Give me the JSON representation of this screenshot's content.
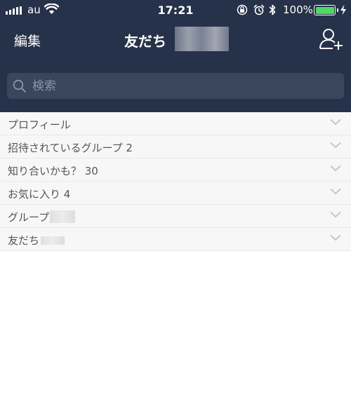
{
  "status_bar": {
    "carrier": "au",
    "time": "17:21",
    "battery_percent": "100%",
    "battery_level": 1.0,
    "icons": [
      "signal-icon",
      "wifi-icon",
      "orientation-lock-icon",
      "alarm-icon",
      "bluetooth-icon",
      "battery-icon",
      "charging-icon"
    ]
  },
  "nav": {
    "edit_label": "編集",
    "title": "友だち",
    "add_friend_icon": "add-friend-icon"
  },
  "search": {
    "placeholder": "検索",
    "value": ""
  },
  "list": {
    "items": [
      {
        "label": "プロフィール"
      },
      {
        "label": "招待されているグループ 2"
      },
      {
        "label": "知り合いかも？ 30"
      },
      {
        "label": "お気に入り 4"
      },
      {
        "label": "グループ"
      },
      {
        "label": "友だち"
      }
    ]
  },
  "colors": {
    "header_bg": "#263249",
    "search_bg": "#3a465c",
    "list_bg": "#f7f7f7",
    "battery_green": "#4cd964"
  }
}
